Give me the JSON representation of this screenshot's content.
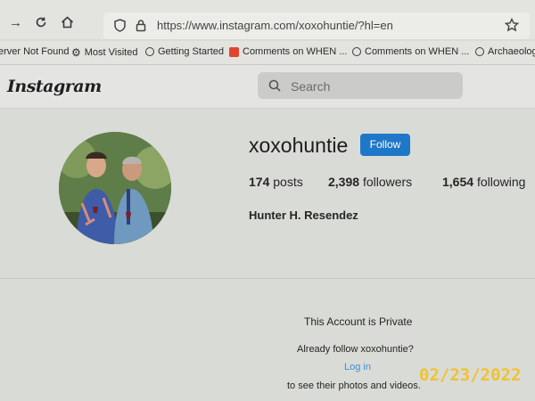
{
  "browser": {
    "url": "https://www.instagram.com/xoxohuntie/?hl=en",
    "bookmarks": [
      {
        "label": "erver Not Found",
        "icon": "none"
      },
      {
        "label": "Most Visited",
        "icon": "gear-icon"
      },
      {
        "label": "Getting Started",
        "icon": "globe-icon"
      },
      {
        "label": "Comments on WHEN ...",
        "icon": "blogger-icon"
      },
      {
        "label": "Comments on WHEN ...",
        "icon": "globe-icon"
      },
      {
        "label": "Archaeolog",
        "icon": "globe-icon"
      }
    ]
  },
  "instagram": {
    "logo": "Instagram",
    "search_placeholder": "Search"
  },
  "profile": {
    "username": "xoxohuntie",
    "follow_label": "Follow",
    "posts_count": "174",
    "posts_label": "posts",
    "followers_count": "2,398",
    "followers_label": "followers",
    "following_count": "1,654",
    "following_label": "following",
    "full_name": "Hunter H. Resendez"
  },
  "private": {
    "title": "This Account is Private",
    "question": "Already follow xoxohuntie?",
    "login": "Log in",
    "subtitle": "to see their photos and videos."
  },
  "photo_timestamp": "02/23/2022",
  "colors": {
    "follow_button": "#1f77c8",
    "link": "#3b8fd6",
    "timestamp": "#f1c232"
  }
}
